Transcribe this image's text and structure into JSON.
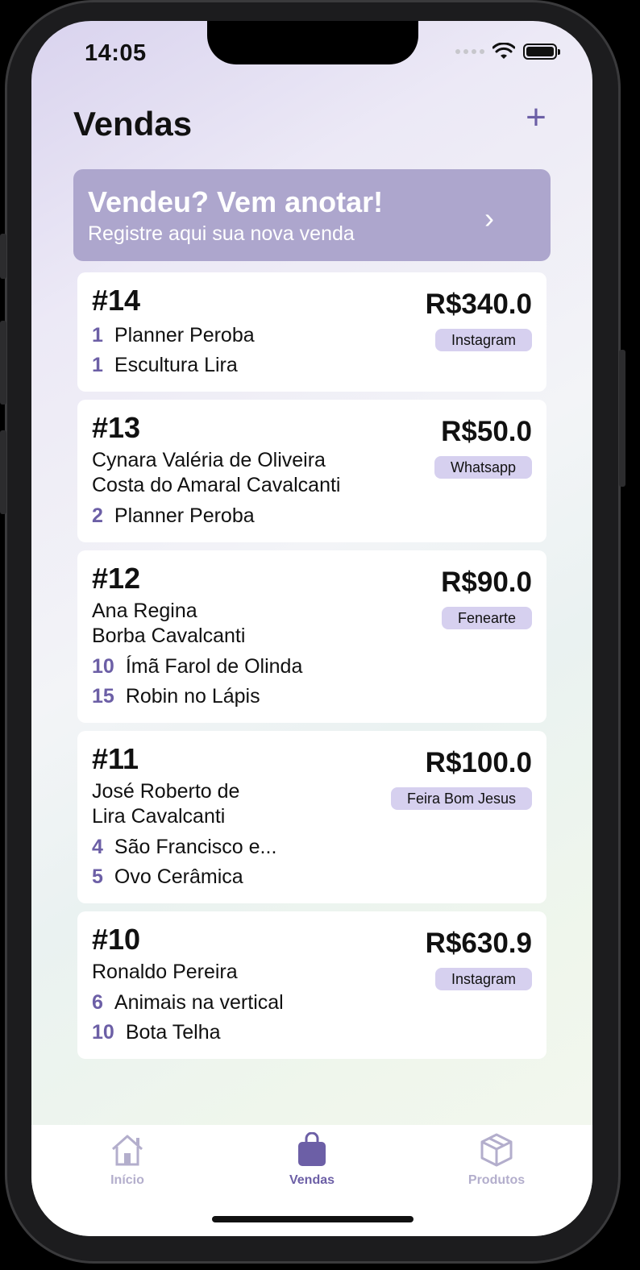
{
  "status": {
    "time": "14:05"
  },
  "header": {
    "title": "Vendas",
    "add_label": "+"
  },
  "banner": {
    "title": "Vendeu? Vem anotar!",
    "subtitle": "Registre aqui sua nova venda",
    "chevron": "›"
  },
  "colors": {
    "accent": "#6c5fa6",
    "banner": "#ada6cd",
    "tag": "#d6d0ef"
  },
  "sales": [
    {
      "id": "#14",
      "client": "",
      "price": "R$340.0",
      "channel": "Instagram",
      "items": [
        {
          "qty": "1",
          "name": "Planner Peroba"
        },
        {
          "qty": "1",
          "name": "Escultura Lira"
        }
      ]
    },
    {
      "id": "#13",
      "client": "Cynara Valéria de Oliveira\nCosta do Amaral Cavalcanti",
      "price": "R$50.0",
      "channel": "Whatsapp",
      "items": [
        {
          "qty": "2",
          "name": "Planner Peroba"
        }
      ]
    },
    {
      "id": "#12",
      "client": "Ana Regina\nBorba Cavalcanti",
      "price": "R$90.0",
      "channel": "Fenearte",
      "items": [
        {
          "qty": "10",
          "name": "Ímã Farol de Olinda"
        },
        {
          "qty": "15",
          "name": "Robin no Lápis"
        }
      ]
    },
    {
      "id": "#11",
      "client": "José Roberto de\nLira Cavalcanti",
      "price": "R$100.0",
      "channel": "Feira Bom Jesus",
      "items": [
        {
          "qty": "4",
          "name": "São Francisco e..."
        },
        {
          "qty": "5",
          "name": "Ovo Cerâmica"
        }
      ]
    },
    {
      "id": "#10",
      "client": "Ronaldo Pereira",
      "price": "R$630.9",
      "channel": "Instagram",
      "items": [
        {
          "qty": "6",
          "name": "Animais na vertical"
        },
        {
          "qty": "10",
          "name": "Bota Telha"
        }
      ]
    }
  ],
  "tabs": [
    {
      "label": "Início",
      "icon": "house-icon",
      "active": false
    },
    {
      "label": "Vendas",
      "icon": "bag-icon",
      "active": true
    },
    {
      "label": "Produtos",
      "icon": "box-icon",
      "active": false
    }
  ]
}
